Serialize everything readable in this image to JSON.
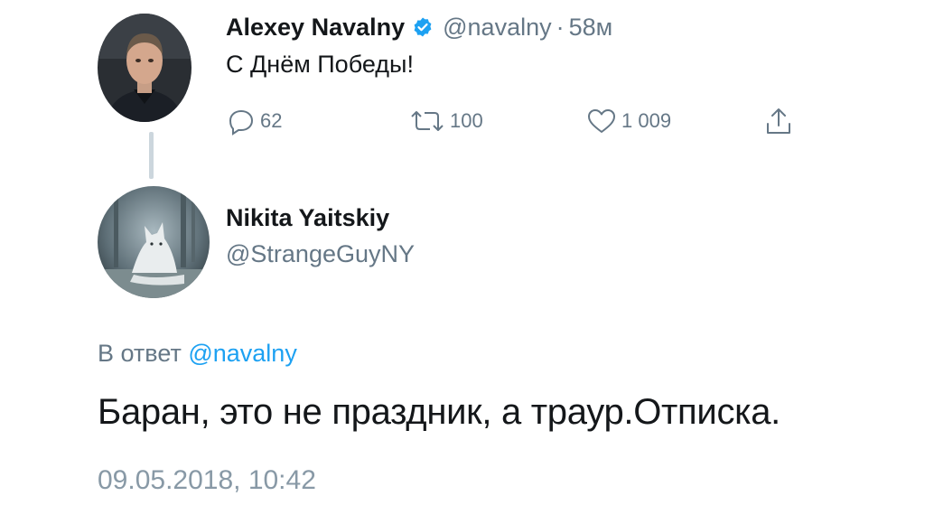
{
  "parent_tweet": {
    "display_name": "Alexey Navalny",
    "handle": "@navalny",
    "separator": "·",
    "time": "58м",
    "text": "С Днём Победы!",
    "actions": {
      "replies": "62",
      "retweets": "100",
      "likes": "1 009"
    }
  },
  "reply_tweet": {
    "display_name": "Nikita Yaitskiy",
    "handle": "@StrangeGuyNY",
    "reply_to_prefix": "В ответ",
    "reply_to_mention": "@navalny",
    "text": "Баран, это не праздник, а траур.Отписка.",
    "timestamp": "09.05.2018, 10:42"
  },
  "icons": {
    "verified": "verified-badge-icon",
    "reply": "reply-icon",
    "retweet": "retweet-icon",
    "like": "heart-icon",
    "share": "share-icon"
  },
  "colors": {
    "text": "#14171a",
    "secondary": "#657786",
    "accent": "#1da1f2",
    "thread_line": "#ccd6dd"
  }
}
